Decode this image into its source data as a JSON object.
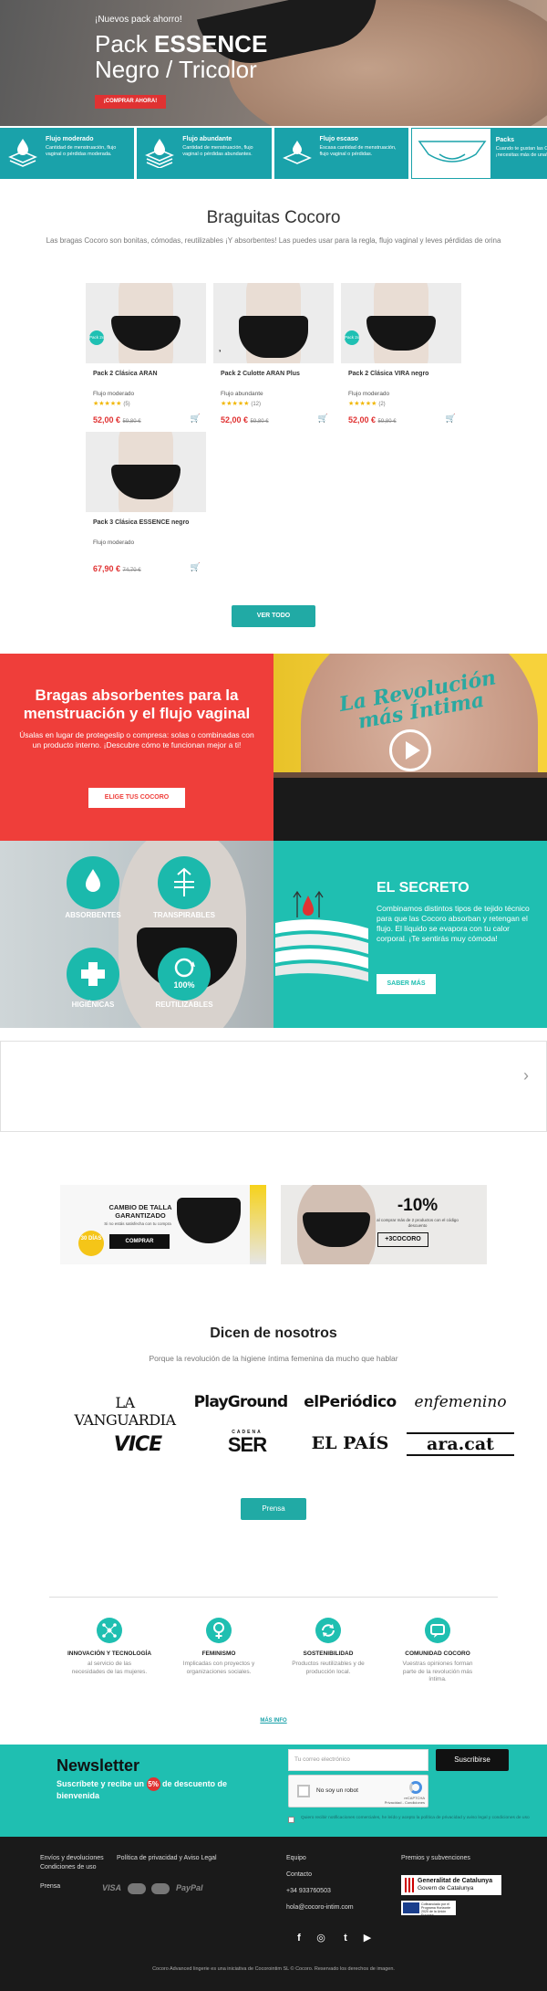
{
  "hero": {
    "kicker": "¡Nuevos pack ahorro!",
    "title_prefix": "Pack ",
    "title_bold": "ESSENCE",
    "title_line2": "Negro / Tricolor",
    "cta": "¡COMPRAR AHORA!"
  },
  "features": [
    {
      "title": "Flujo moderado",
      "desc": "Cantidad de menstruación, flujo vaginal o pérdidas moderada.",
      "icon": "drop-stack-icon"
    },
    {
      "title": "Flujo abundante",
      "desc": "Cantidad de menstruación, flujo vaginal o pérdidas abundantes.",
      "icon": "drop-stack-icon"
    },
    {
      "title": "Flujo escaso",
      "desc": "Escasa cantidad de menstruación, flujo vaginal o pérdidas.",
      "icon": "drop-stack-icon"
    },
    {
      "title": "Packs",
      "desc": "Cuando te gustan las Cocoro, ¡necesitas más de una!",
      "icon": "panties-pack-icon"
    }
  ],
  "section": {
    "title": "Braguitas Cocoro",
    "desc": "Las bragas Cocoro son bonitas, cómodas, reutilizables ¡Y absorbentes! Las puedes usar para la regla, flujo vaginal y leves pérdidas de orina"
  },
  "products": [
    {
      "name": "Pack 2 Clásica ARAN",
      "category": "Flujo moderado",
      "stars": "★★★★★",
      "reviews": "(5)",
      "price": "52,00 €",
      "old_price": "59,80 €",
      "badge": "Pack 2x"
    },
    {
      "name": "Pack 2 Culotte ARAN Plus",
      "category": "Flujo abundante",
      "stars": "★★★★★",
      "reviews": "(12)",
      "price": "52,00 €",
      "old_price": "59,80 €",
      "badge": ""
    },
    {
      "name": "Pack 2 Clásica VIRA negro",
      "category": "Flujo moderado",
      "stars": "★★★★★",
      "reviews": "(2)",
      "price": "52,00 €",
      "old_price": "59,80 €",
      "badge": "Pack 2x"
    },
    {
      "name": "Pack 3 Clásica ESSENCE negro",
      "category": "Flujo moderado",
      "stars": "",
      "reviews": "",
      "price": "67,90 €",
      "old_price": "74,70 €",
      "badge": ""
    }
  ],
  "ver_todo": "VER TODO",
  "red_block": {
    "title": "Bragas absorbentes para la menstruación y el flujo vaginal",
    "text": "Úsalas en lugar de protegeslip o compresa: solas o combinadas con un producto interno. ¡Descubre cómo te funcionan mejor a ti!",
    "button": "ELIGE TUS COCORO"
  },
  "video": {
    "tattoo": "La Revolución más Íntima"
  },
  "benefits": [
    "ABSORBENTES",
    "TRANSPIRABLES",
    "HIGIÉNICAS",
    "REUTILIZABLES"
  ],
  "benefit_badge": "100%",
  "secret": {
    "title": "EL SECRETO",
    "text": "Combinamos distintos tipos de tejido técnico para que las Cocoro absorban y retengan el flujo. El líquido se evapora con tu calor corporal. ¡Te sentirás muy cómoda!",
    "button": "SABER MÁS"
  },
  "promo1": {
    "title": "CAMBIO DE TALLA GARANTIZADO",
    "sub": "Si no estás satisfecha con tu compra",
    "button": "COMPRAR",
    "seal": "30 DÍAS"
  },
  "promo2": {
    "pct": "-10%",
    "sub": "al comprar más de 2 productos con el código descuento",
    "code": "+3COCORO"
  },
  "press": {
    "title": "Dicen de nosotros",
    "sub": "Porque la revolución de la higiene íntima femenina da mucho que hablar",
    "logos": [
      "LA VANGUARDIA",
      "PlayGround",
      "elPeriódico",
      "enfemenino",
      "VICE",
      "SER",
      "EL PAÍS",
      "ara.cat"
    ],
    "ser_top": "CADENA",
    "button": "Prensa"
  },
  "values": [
    {
      "title": "INNOVACIÓN Y TECNOLOGÍA",
      "desc": "al servicio de las necesidades de las mujeres."
    },
    {
      "title": "FEMINISMO",
      "desc": "Implicadas con proyectos y organizaciones sociales."
    },
    {
      "title": "SOSTENIBILIDAD",
      "desc": "Productos reutilizables y de producción local."
    },
    {
      "title": "COMUNIDAD COCORO",
      "desc": "Vuestras opiniones forman parte de la revolución más íntima."
    }
  ],
  "mas_info": "MÁS INFO",
  "newsletter": {
    "title": "Newsletter",
    "sub_before": "Suscríbete y recibe un ",
    "pct": "5%",
    "sub_after": " de descuento de bienvenida",
    "email_placeholder": "Tu correo electrónico",
    "button": "Suscribirse",
    "captcha_label": "No soy un robot",
    "captcha_brand": "reCAPTCHA",
    "captcha_links": "Privacidad - Condiciones",
    "consent": "Quiero recibir notificaciones comerciales, he leído y acepto la política de privacidad y aviso legal y condiciones de uso"
  },
  "footer": {
    "links_left": [
      "Envíos y devoluciones",
      "Política de privacidad y Aviso Legal",
      "Condiciones de uso"
    ],
    "prensa": "Prensa",
    "payments": [
      "VISA",
      "PayPal"
    ],
    "col2": [
      "Equipo",
      "Contacto",
      "+34 933760503",
      "hola@cocoro-intim.com"
    ],
    "col3_title": "Premios y subvenciones",
    "gencat_1": "Generalitat de Catalunya",
    "gencat_2": "Govern de Catalunya",
    "eu_text": "Cofinanciado por el Programa Horizonte 2020 de la Unión Europea",
    "social": [
      "f",
      "◎",
      "t",
      "▶"
    ],
    "copyright": "Cocoro Advanced lingerie es una iniciativa de Cocorointim SL © Cocoro. Reservado los derechos de imagen."
  }
}
